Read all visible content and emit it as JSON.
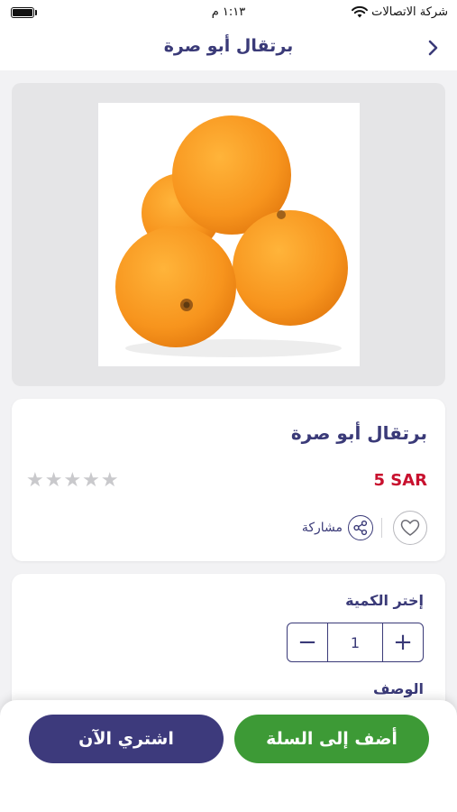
{
  "status_bar": {
    "carrier": "شركة الاتصالات",
    "time": "١:١٣ م"
  },
  "nav": {
    "title": "برتقال أبو صرة",
    "back_icon": "chevron-left-icon"
  },
  "product": {
    "image_alt": "orange-fruit-photo",
    "name": "برتقال أبو صرة",
    "price": "5 SAR",
    "rating": 0,
    "rating_max": 5,
    "rating_stars": "★★★★★",
    "share_label": "مشاركة",
    "favorite_icon": "heart-icon",
    "share_icon": "share-icon"
  },
  "quantity": {
    "title": "إختر الكمية",
    "value": "1",
    "minus": "−",
    "plus": "+"
  },
  "description": {
    "title": "الوصف"
  },
  "actions": {
    "add_to_cart": "أضف إلى السلة",
    "buy_now": "اشتري الآن"
  },
  "colors": {
    "primary": "#3a3a78",
    "price": "#c8102e",
    "add_to_cart": "#3d9a36",
    "buy_now": "#3d3a7c"
  }
}
